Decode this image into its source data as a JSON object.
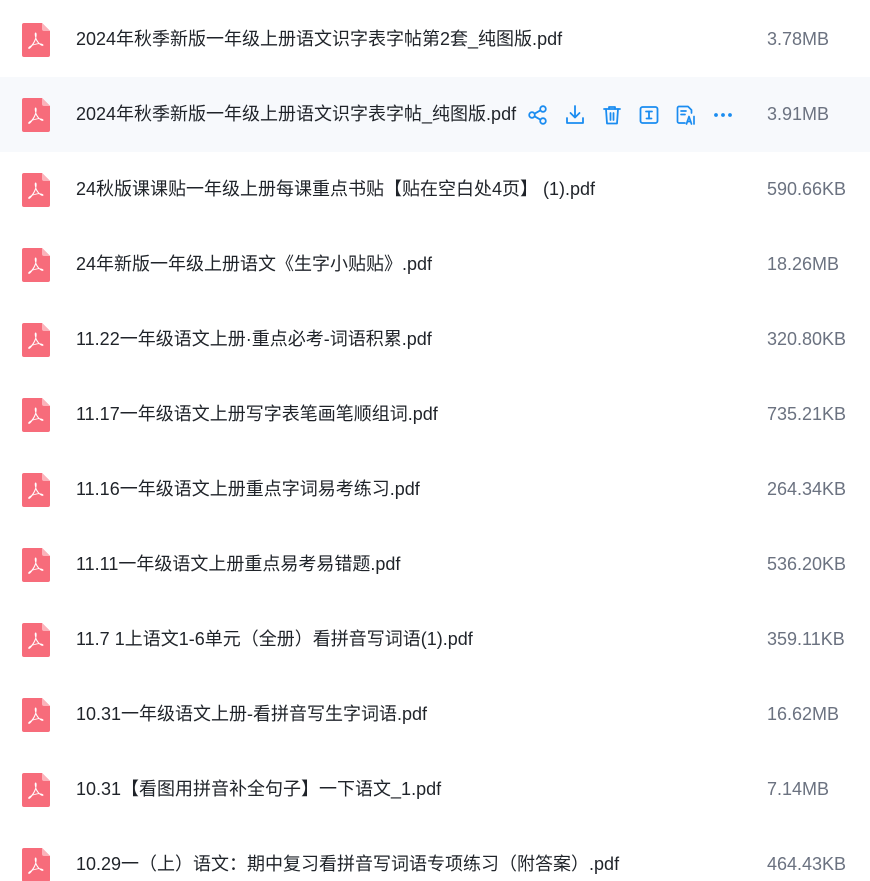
{
  "files": [
    {
      "name": "2024年秋季新版一年级上册语文识字表字帖第2套_纯图版.pdf",
      "size": "3.78MB"
    },
    {
      "name": "2024年秋季新版一年级上册语文识字表字帖_纯图版.pdf",
      "size": "3.91MB"
    },
    {
      "name": "24秋版课课贴一年级上册每课重点书贴【贴在空白处4页】 (1).pdf",
      "size": "590.66KB"
    },
    {
      "name": "24年新版一年级上册语文《生字小贴贴》.pdf",
      "size": "18.26MB"
    },
    {
      "name": "11.22一年级语文上册·重点必考-词语积累.pdf",
      "size": "320.80KB"
    },
    {
      "name": "11.17一年级语文上册写字表笔画笔顺组词.pdf",
      "size": "735.21KB"
    },
    {
      "name": "11.16一年级语文上册重点字词易考练习.pdf",
      "size": "264.34KB"
    },
    {
      "name": "11.11一年级语文上册重点易考易错题.pdf",
      "size": "536.20KB"
    },
    {
      "name": "11.7 1上语文1-6单元（全册）看拼音写词语(1).pdf",
      "size": "359.11KB"
    },
    {
      "name": "10.31一年级语文上册-看拼音写生字词语.pdf",
      "size": "16.62MB"
    },
    {
      "name": "10.31【看图用拼音补全句子】一下语文_1.pdf",
      "size": "7.14MB"
    },
    {
      "name": "10.29一（上）语文：期中复习看拼音写词语专项练习（附答案）.pdf",
      "size": "464.43KB"
    }
  ],
  "hovered_row": 1,
  "row_actions": [
    "share-icon",
    "download-icon",
    "delete-icon",
    "rename-icon",
    "ai-summary-icon",
    "more-icon"
  ],
  "colors": {
    "pdf_icon": "#f76c7b",
    "action_icon": "#1a8cf0",
    "hover_row_bg": "#f7f9fc",
    "name_text": "#1f2329",
    "size_text": "#6b7280"
  }
}
